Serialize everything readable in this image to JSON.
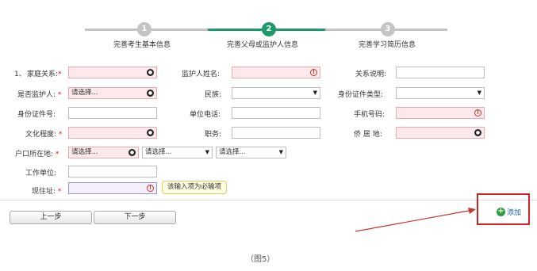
{
  "stepper": {
    "steps": [
      {
        "number": "1",
        "label": "完善考生基本信息",
        "state": "done"
      },
      {
        "number": "2",
        "label": "完善父母或监护人信息",
        "state": "active"
      },
      {
        "number": "3",
        "label": "完善学习简历信息",
        "state": "todo"
      }
    ],
    "colors": {
      "active": "#1e9a6a",
      "inactive": "#c4c4c4"
    }
  },
  "form": {
    "row_prefix": "1、",
    "relation_label": "家庭关系:",
    "guardian_name_label": "监护人姓名:",
    "relation_note_label": "关系说明:",
    "is_guardian_label": "是否监护人:",
    "is_guardian_value": "请选择...",
    "ethnicity_label": "民族:",
    "id_type_label": "身份证件类型:",
    "id_number_label": "身份证件号:",
    "work_phone_label": "单位电话:",
    "mobile_label": "手机号码:",
    "education_label": "文化程度:",
    "job_label": "职务:",
    "overseas_label": "侨 居 地:",
    "hukou_label": "户口所在地:",
    "hukou_province": "请选择...",
    "hukou_city": "请选择...",
    "hukou_district": "请选择...",
    "employer_label": "工作单位:",
    "address_label": "现住址:",
    "required_mark": "*",
    "tooltip": "该输入项为必输项"
  },
  "buttons": {
    "prev": "上一步",
    "next": "下一步",
    "add": "添加"
  },
  "caption": "（图5）",
  "colors": {
    "highlight_box": "#d1232a",
    "arrow": "#c0392b",
    "error_field": "#fbe9ec"
  }
}
